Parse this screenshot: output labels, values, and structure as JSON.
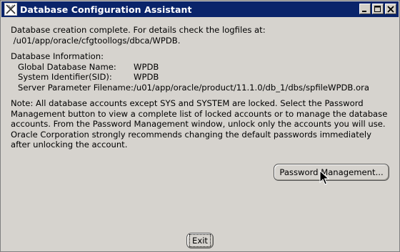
{
  "window": {
    "title": "Database Configuration Assistant",
    "buttons": {
      "minimize": "minimize-icon",
      "maximize": "maximize-icon",
      "close": "close-icon"
    }
  },
  "message": {
    "line1": "Database creation complete. For details check the logfiles at:",
    "line2": " /u01/app/oracle/cfgtoollogs/dbca/WPDB."
  },
  "db_info": {
    "heading": "Database Information:",
    "rows": [
      {
        "label": "Global Database Name:",
        "value": "WPDB"
      },
      {
        "label": "System Identifier(SID):",
        "value": "WPDB"
      },
      {
        "label": "Server Parameter Filename:",
        "value": "/u01/app/oracle/product/11.1.0/db_1/dbs/spfileWPDB.ora"
      }
    ]
  },
  "note": {
    "lines": [
      "Note: All database accounts except SYS and SYSTEM are locked. Select the Password",
      "Management button to view a complete list of locked accounts or to manage the database",
      "accounts. From the Password Management window, unlock only the accounts you will use.",
      "Oracle Corporation strongly recommends changing the default passwords immediately",
      "after unlocking the account."
    ]
  },
  "buttons": {
    "password_management": "Password Management...",
    "exit": "Exit"
  },
  "colors": {
    "titlebar": "#0a246a",
    "window_bg": "#d6d3ce"
  }
}
